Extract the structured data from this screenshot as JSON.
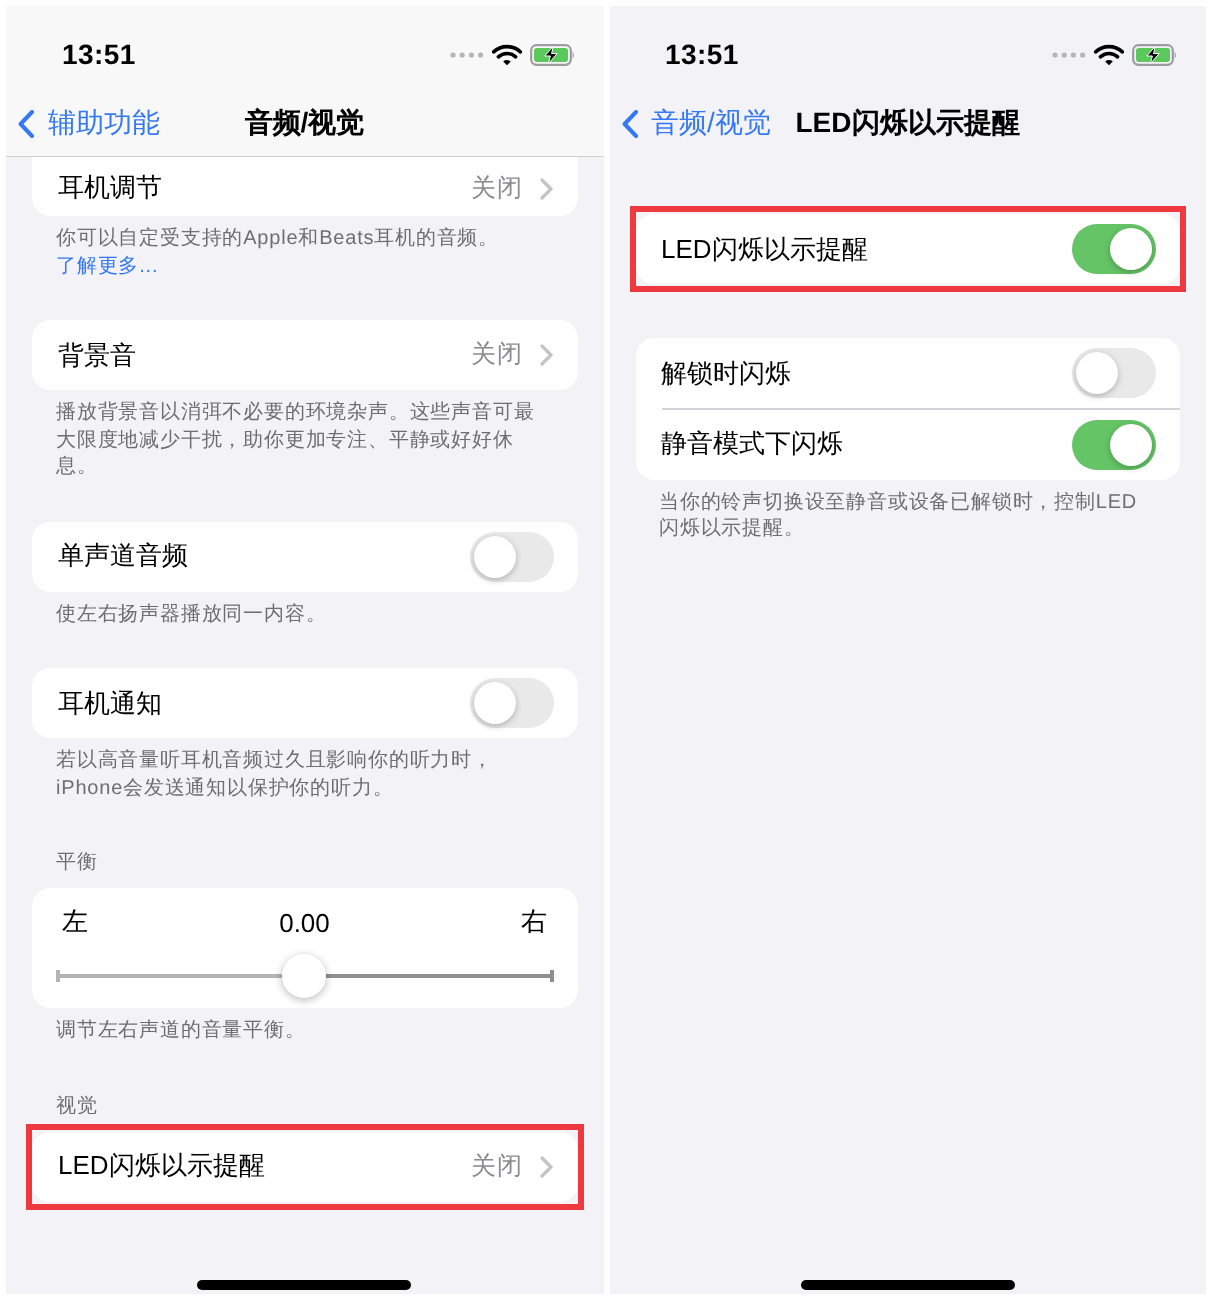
{
  "screens": [
    {
      "status_bar": {
        "time": "13:51"
      },
      "scrolled": true,
      "nav_bar": {
        "back": "辅助功能",
        "title": "音频/视觉"
      },
      "groups": [
        {
          "highlighted": false,
          "rows": [
            {
              "kind": "disclosure",
              "label": "耳机调节",
              "value": "关闭"
            }
          ],
          "footer": {
            "text": "你可以自定受支持的Apple和Beats耳机的音频。",
            "link": "了解更多..."
          }
        },
        {
          "highlighted": false,
          "rows": [
            {
              "kind": "disclosure",
              "label": "背景音",
              "value": "关闭"
            }
          ],
          "footer": {
            "text": "播放背景音以消弭不必要的环境杂声。这些声音可最大限度地减少干扰，助你更加专注、平静或好好休息。"
          }
        },
        {
          "highlighted": false,
          "rows": [
            {
              "kind": "toggle",
              "label": "单声道音频",
              "on": false
            }
          ],
          "footer": {
            "text": "使左右扬声器播放同一内容。"
          }
        },
        {
          "highlighted": false,
          "rows": [
            {
              "kind": "toggle",
              "label": "耳机通知",
              "on": false
            }
          ],
          "footer": {
            "text": "若以高音量听耳机音频过久且影响你的听力时，iPhone会发送通知以保护你的听力。"
          }
        },
        {
          "highlighted": false,
          "header": "平衡",
          "rows": [
            {
              "kind": "slider",
              "min_label": "左",
              "value": "0.00",
              "max_label": "右",
              "level": 0.5
            }
          ],
          "footer": {
            "text": "调节左右声道的音量平衡。"
          }
        },
        {
          "highlighted": true,
          "header": "视觉",
          "rows": [
            {
              "kind": "disclosure",
              "label": "LED闪烁以示提醒",
              "value": "关闭"
            }
          ]
        }
      ]
    },
    {
      "status_bar": {
        "time": "13:51"
      },
      "scrolled": false,
      "nav_bar": {
        "back": "音频/视觉",
        "title": "LED闪烁以示提醒"
      },
      "groups": [
        {
          "highlighted": true,
          "rows": [
            {
              "kind": "toggle",
              "label": "LED闪烁以示提醒",
              "on": true
            }
          ]
        },
        {
          "highlighted": false,
          "rows": [
            {
              "kind": "toggle",
              "label": "解锁时闪烁",
              "on": false
            },
            {
              "kind": "toggle",
              "label": "静音模式下闪烁",
              "on": true
            }
          ],
          "footer": {
            "text": "当你的铃声切换设至静音或设备已解锁时，控制LED闪烁以示提醒。"
          }
        }
      ]
    }
  ]
}
